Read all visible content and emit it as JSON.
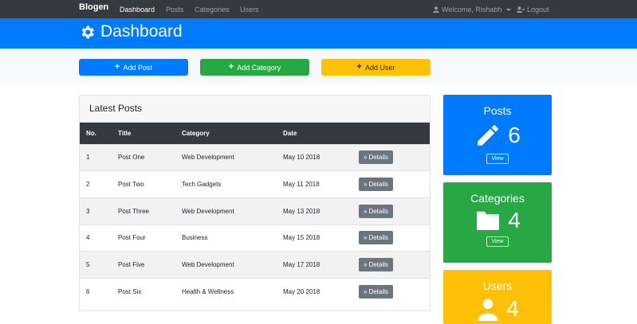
{
  "navbar": {
    "brand": "Blogen",
    "links": [
      "Dashboard",
      "Posts",
      "Categories",
      "Users"
    ],
    "welcome": "Welcome, Rishabh",
    "logout": "Logout"
  },
  "header": {
    "title": "Dashboard"
  },
  "actions": {
    "add_post": "Add Post",
    "add_category": "Add Category",
    "add_user": "Add User"
  },
  "latest": {
    "title": "Latest Posts",
    "columns": [
      "No.",
      "Title",
      "Category",
      "Date"
    ],
    "details_label": "Details",
    "rows": [
      {
        "no": "1",
        "title": "Post One",
        "category": "Web Development",
        "date": "May 10 2018"
      },
      {
        "no": "2",
        "title": "Post Two",
        "category": "Tech Gadgets",
        "date": "May 11 2018"
      },
      {
        "no": "3",
        "title": "Post Three",
        "category": "Web Development",
        "date": "May 13 2018"
      },
      {
        "no": "4",
        "title": "Post Four",
        "category": "Business",
        "date": "May 15 2018"
      },
      {
        "no": "5",
        "title": "Post Five",
        "category": "Web Development",
        "date": "May 17 2018"
      },
      {
        "no": "6",
        "title": "Post Six",
        "category": "Health & Wellness",
        "date": "May 20 2018"
      }
    ]
  },
  "stats": {
    "posts": {
      "label": "Posts",
      "count": "6",
      "view": "View"
    },
    "categories": {
      "label": "Categories",
      "count": "4",
      "view": "View"
    },
    "users": {
      "label": "Users",
      "count": "4"
    }
  },
  "colors": {
    "primary": "#007bff",
    "success": "#28a745",
    "warning": "#ffc107",
    "dark": "#343a40",
    "secondary": "#6c757d"
  }
}
